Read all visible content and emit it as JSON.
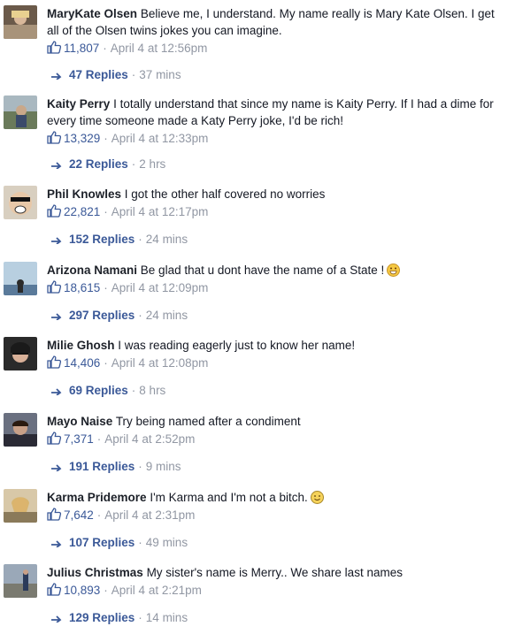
{
  "comments": [
    {
      "author": "MaryKate Olsen",
      "text": "Believe me, I understand. My name really is Mary Kate Olsen. I get all of the Olsen twins jokes you can imagine.",
      "likes": "11,807",
      "timestamp": "April 4 at 12:56pm",
      "replies": "47 Replies",
      "reply_age": "37 mins",
      "avatar_color": "#6b5a4a"
    },
    {
      "author": "Kaity Perry",
      "text": "I totally understand that since my name is Kaity Perry. If I had a dime for every time someone made a Katy Perry joke, I'd be rich!",
      "likes": "13,329",
      "timestamp": "April 4 at 12:33pm",
      "replies": "22 Replies",
      "reply_age": "2 hrs",
      "avatar_color": "#7a8a6a"
    },
    {
      "author": "Phil Knowles",
      "text": "I got the other half covered no worries",
      "likes": "22,821",
      "timestamp": "April 4 at 12:17pm",
      "replies": "152 Replies",
      "reply_age": "24 mins",
      "avatar_color": "#c9b89a"
    },
    {
      "author": "Arizona Namani",
      "text": "Be glad that u dont have the name of a State !",
      "likes": "18,615",
      "timestamp": "April 4 at 12:09pm",
      "replies": "297 Replies",
      "reply_age": "24 mins",
      "avatar_color": "#8fb0c8",
      "emoji": "grin"
    },
    {
      "author": "Milie Ghosh",
      "text": "I was reading eagerly just to know her name!",
      "likes": "14,406",
      "timestamp": "April 4 at 12:08pm",
      "replies": "69 Replies",
      "reply_age": "8 hrs",
      "avatar_color": "#3a3a3a"
    },
    {
      "author": "Mayo Naise",
      "text": "Try being named after a condiment",
      "likes": "7,371",
      "timestamp": "April 4 at 2:52pm",
      "replies": "191 Replies",
      "reply_age": "9 mins",
      "avatar_color": "#4a4a55"
    },
    {
      "author": "Karma Pridemore",
      "text": "I'm Karma and I'm not a bitch.",
      "likes": "7,642",
      "timestamp": "April 4 at 2:31pm",
      "replies": "107 Replies",
      "reply_age": "49 mins",
      "avatar_color": "#b89a6a",
      "emoji": "smile"
    },
    {
      "author": "Julius Christmas",
      "text": "My sister's name is Merry.. We share last names",
      "likes": "10,893",
      "timestamp": "April 4 at 2:21pm",
      "replies": "129 Replies",
      "reply_age": "14 mins",
      "avatar_color": "#5a6a7a"
    }
  ],
  "colors": {
    "link": "#3b5998",
    "meta": "#9197a3",
    "text": "#141823"
  }
}
